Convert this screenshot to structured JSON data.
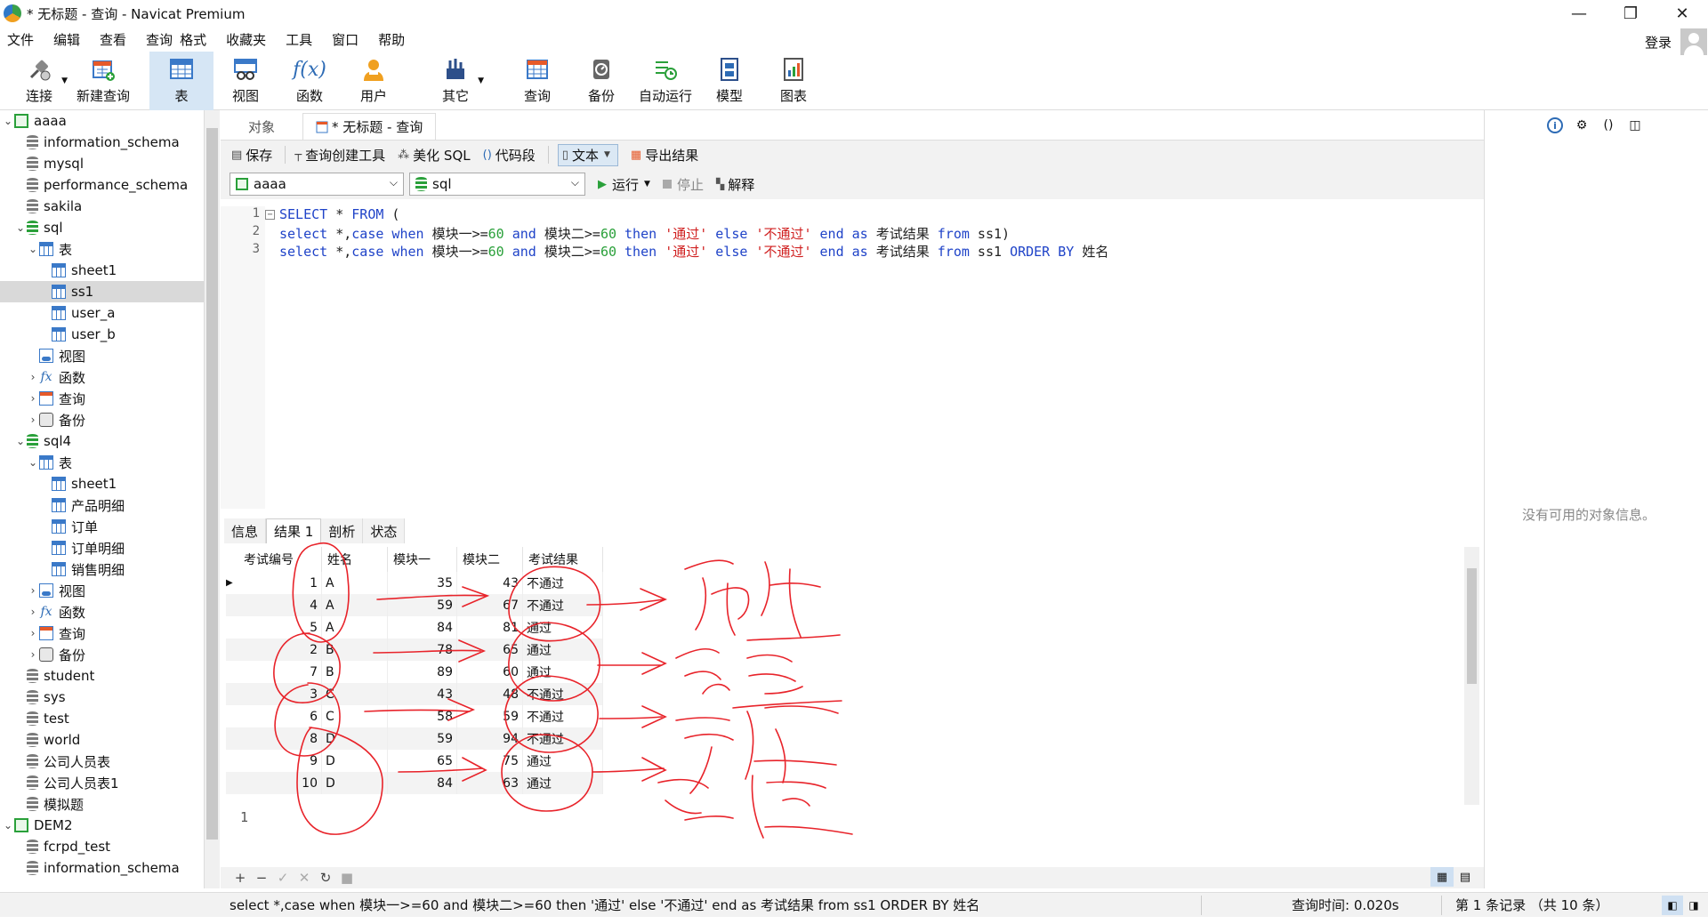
{
  "window": {
    "title": "* 无标题 - 查询 - Navicat Premium",
    "minimize": "—",
    "restore": "❐",
    "close": "✕"
  },
  "menu": [
    "文件",
    "编辑",
    "查看",
    "查询",
    "格式",
    "收藏夹",
    "工具",
    "窗口",
    "帮助"
  ],
  "login": {
    "label": "登录"
  },
  "toolbar": [
    {
      "label": "连接",
      "icon": "plug-icon",
      "caret": true
    },
    {
      "label": "新建查询",
      "icon": "new-query-icon"
    },
    {
      "label": "表",
      "icon": "table-icon",
      "active": true
    },
    {
      "label": "视图",
      "icon": "view-icon"
    },
    {
      "label": "函数",
      "icon": "function-icon"
    },
    {
      "label": "用户",
      "icon": "user-icon"
    },
    {
      "label": "其它",
      "icon": "other-icon",
      "caret": true
    },
    {
      "label": "查询",
      "icon": "query-icon"
    },
    {
      "label": "备份",
      "icon": "backup-icon"
    },
    {
      "label": "自动运行",
      "icon": "auto-run-icon"
    },
    {
      "label": "模型",
      "icon": "model-icon"
    },
    {
      "label": "图表",
      "icon": "chart-icon"
    }
  ],
  "tree": [
    {
      "label": "aaaa",
      "level": 0,
      "type": "connection",
      "expanded": true
    },
    {
      "label": "information_schema",
      "level": 1,
      "type": "db"
    },
    {
      "label": "mysql",
      "level": 1,
      "type": "db"
    },
    {
      "label": "performance_schema",
      "level": 1,
      "type": "db"
    },
    {
      "label": "sakila",
      "level": 1,
      "type": "db"
    },
    {
      "label": "sql",
      "level": 1,
      "type": "db-open",
      "expanded": true
    },
    {
      "label": "表",
      "level": 2,
      "type": "table",
      "expanded": true
    },
    {
      "label": "sheet1",
      "level": 3,
      "type": "table"
    },
    {
      "label": "ss1",
      "level": 3,
      "type": "table",
      "selected": true
    },
    {
      "label": "user_a",
      "level": 3,
      "type": "table"
    },
    {
      "label": "user_b",
      "level": 3,
      "type": "table"
    },
    {
      "label": "视图",
      "level": 2,
      "type": "view"
    },
    {
      "label": "函数",
      "level": 2,
      "type": "fx",
      "collapsed": true
    },
    {
      "label": "查询",
      "level": 2,
      "type": "query",
      "collapsed": true
    },
    {
      "label": "备份",
      "level": 2,
      "type": "backup",
      "collapsed": true
    },
    {
      "label": "sql4",
      "level": 1,
      "type": "db-open",
      "expanded": true
    },
    {
      "label": "表",
      "level": 2,
      "type": "table",
      "expanded": true
    },
    {
      "label": "sheet1",
      "level": 3,
      "type": "table"
    },
    {
      "label": "产品明细",
      "level": 3,
      "type": "table"
    },
    {
      "label": "订单",
      "level": 3,
      "type": "table"
    },
    {
      "label": "订单明细",
      "level": 3,
      "type": "table"
    },
    {
      "label": "销售明细",
      "level": 3,
      "type": "table"
    },
    {
      "label": "视图",
      "level": 2,
      "type": "view",
      "collapsed": true
    },
    {
      "label": "函数",
      "level": 2,
      "type": "fx",
      "collapsed": true
    },
    {
      "label": "查询",
      "level": 2,
      "type": "query",
      "collapsed": true
    },
    {
      "label": "备份",
      "level": 2,
      "type": "backup",
      "collapsed": true
    },
    {
      "label": "student",
      "level": 1,
      "type": "db"
    },
    {
      "label": "sys",
      "level": 1,
      "type": "db"
    },
    {
      "label": "test",
      "level": 1,
      "type": "db"
    },
    {
      "label": "world",
      "level": 1,
      "type": "db"
    },
    {
      "label": "公司人员表",
      "level": 1,
      "type": "db"
    },
    {
      "label": "公司人员表1",
      "level": 1,
      "type": "db"
    },
    {
      "label": "模拟题",
      "level": 1,
      "type": "db"
    },
    {
      "label": "DEM2",
      "level": 0,
      "type": "connection",
      "expanded": true
    },
    {
      "label": "fcrpd_test",
      "level": 1,
      "type": "db"
    },
    {
      "label": "information_schema",
      "level": 1,
      "type": "db"
    }
  ],
  "tabs": {
    "objects": "对象",
    "query": "* 无标题 - 查询"
  },
  "editor_toolbar": {
    "save": "保存",
    "builder": "查询创建工具",
    "beautify": "美化 SQL",
    "snippet": "代码段",
    "text": "文本",
    "export": "导出结果"
  },
  "selectors": {
    "connection": "aaaa",
    "database": "sql",
    "run": "运行",
    "stop": "停止",
    "explain": "解释"
  },
  "sql_lines": [
    [
      [
        "kw",
        "SELECT"
      ],
      [
        "plain",
        " * "
      ],
      [
        "kw",
        "FROM"
      ],
      [
        "plain",
        " ("
      ]
    ],
    [
      [
        "kw",
        "select"
      ],
      [
        "plain",
        " *,"
      ],
      [
        "kw",
        "case when"
      ],
      [
        "plain",
        " 模块一>="
      ],
      [
        "num",
        "60"
      ],
      [
        "plain",
        " "
      ],
      [
        "kw",
        "and"
      ],
      [
        "plain",
        " 模块二>="
      ],
      [
        "num",
        "60"
      ],
      [
        "plain",
        " "
      ],
      [
        "kw",
        "then"
      ],
      [
        "plain",
        " "
      ],
      [
        "str",
        "'通过'"
      ],
      [
        "plain",
        " "
      ],
      [
        "kw",
        "else"
      ],
      [
        "plain",
        " "
      ],
      [
        "str",
        "'不通过'"
      ],
      [
        "plain",
        " "
      ],
      [
        "kw",
        "end as"
      ],
      [
        "plain",
        " 考试结果 "
      ],
      [
        "kw",
        "from"
      ],
      [
        "plain",
        " ss1)"
      ]
    ],
    [
      [
        "kw",
        "select"
      ],
      [
        "plain",
        " *,"
      ],
      [
        "kw",
        "case when"
      ],
      [
        "plain",
        " 模块一>="
      ],
      [
        "num",
        "60"
      ],
      [
        "plain",
        " "
      ],
      [
        "kw",
        "and"
      ],
      [
        "plain",
        " 模块二>="
      ],
      [
        "num",
        "60"
      ],
      [
        "plain",
        " "
      ],
      [
        "kw",
        "then"
      ],
      [
        "plain",
        " "
      ],
      [
        "str",
        "'通过'"
      ],
      [
        "plain",
        " "
      ],
      [
        "kw",
        "else"
      ],
      [
        "plain",
        " "
      ],
      [
        "str",
        "'不通过'"
      ],
      [
        "plain",
        " "
      ],
      [
        "kw",
        "end as"
      ],
      [
        "plain",
        " 考试结果 "
      ],
      [
        "kw",
        "from"
      ],
      [
        "plain",
        " ss1 "
      ],
      [
        "kw",
        "ORDER BY"
      ],
      [
        "plain",
        " 姓名"
      ]
    ]
  ],
  "line_numbers": [
    "1",
    "2",
    "3"
  ],
  "right_panel": {
    "empty": "没有可用的对象信息。"
  },
  "result_tabs": [
    "信息",
    "结果 1",
    "剖析",
    "状态"
  ],
  "result": {
    "columns": [
      "考试编号",
      "姓名",
      "模块一",
      "模块二",
      "考试结果"
    ],
    "rows": [
      [
        "1",
        "A",
        "35",
        "43",
        "不通过"
      ],
      [
        "4",
        "A",
        "59",
        "67",
        "不通过"
      ],
      [
        "5",
        "A",
        "84",
        "81",
        "通过"
      ],
      [
        "2",
        "B",
        "78",
        "65",
        "通过"
      ],
      [
        "7",
        "B",
        "89",
        "60",
        "通过"
      ],
      [
        "3",
        "C",
        "43",
        "48",
        "不通过"
      ],
      [
        "6",
        "C",
        "58",
        "59",
        "不通过"
      ],
      [
        "8",
        "D",
        "59",
        "94",
        "不通过"
      ],
      [
        "9",
        "D",
        "65",
        "75",
        "通过"
      ],
      [
        "10",
        "D",
        "84",
        "63",
        "通过"
      ]
    ]
  },
  "grid_second_line": "1",
  "status": {
    "sql": "select *,case when 模块一>=60 and 模块二>=60 then '通过' else '不通过' end as 考试结果 from ss1 ORDER BY 姓名",
    "time": "查询时间: 0.020s",
    "records": "第 1 条记录 （共 10 条）"
  },
  "colors": {
    "accent": "#2d6bb5",
    "keyword": "#1f43c8",
    "number": "#2aa03a",
    "string": "#d02020",
    "annotation": "#e8232a"
  }
}
